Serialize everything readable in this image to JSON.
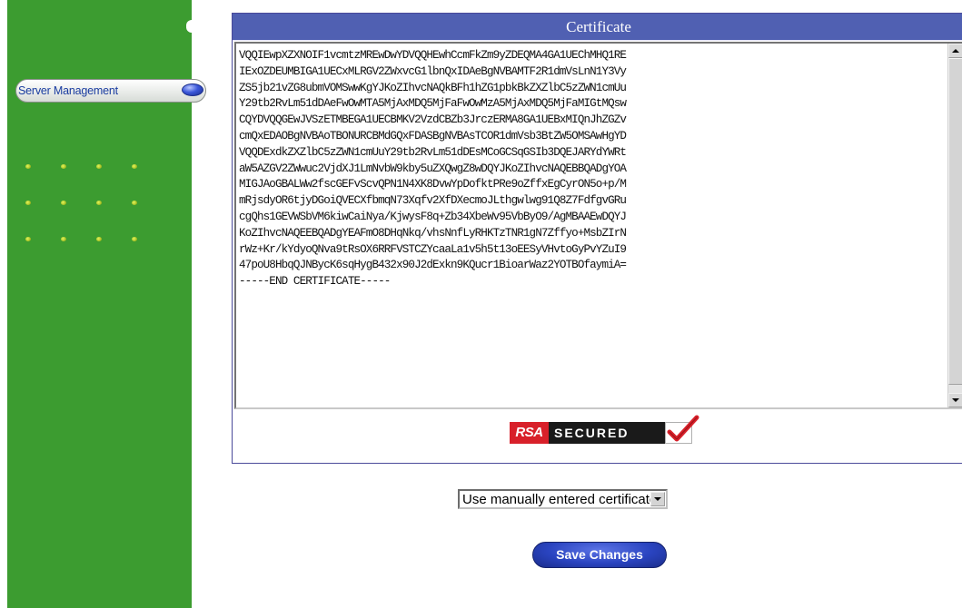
{
  "sidebar": {
    "nav_item_label": "Server Management",
    "dot_rows": 3,
    "dots_per_row": 4
  },
  "certificate": {
    "title": "Certificate",
    "lines": [
      "VQQIEwpXZXNOIF1vcmtzMREwDwYDVQQHEwhCcmFkZm9yZDEQMA4GA1UEChMHQ1RE",
      "IExOZDEUMBIGA1UECxMLRGV2ZWxvcG1lbnQxIDAeBgNVBAMTF2R1dmVsLnN1Y3Vy",
      "ZS5jb21vZG8ubmVOMSwwKgYJKoZIhvcNAQkBFh1hZG1pbkBkZXZlbC5zZWN1cmUu",
      "Y29tb2RvLm51dDAeFwOwMTA5MjAxMDQ5MjFaFwOwMzA5MjAxMDQ5MjFaMIGtMQsw",
      "CQYDVQQGEwJVSzETMBEGA1UECBMKV2VzdCBZb3JrczERMA8GA1UEBxMIQnJhZGZv",
      "cmQxEDAOBgNVBAoTBONURCBMdGQxFDASBgNVBAsTCOR1dmVsb3BtZW5OMSAwHgYD",
      "VQQDExdkZXZlbC5zZWN1cmUuY29tb2RvLm51dDEsMCoGCSqGSIb3DQEJARYdYWRt",
      "aW5AZGV2ZWwuc2VjdXJ1LmNvbW9kby5uZXQwgZ8wDQYJKoZIhvcNAQEBBQADgYOA",
      "MIGJAoGBALWw2fscGEFvScvQPN1N4XK8DvwYpDofktPRe9oZffxEgCyrON5o+p/M",
      "mRjsdyOR6tjyDGoiQVECXfbmqN73Xqfv2XfDXecmoJLthgwlwg91Q8Z7FdfgvGRu",
      "cgQhs1GEVWSbVM6kiwCaiNya/KjwysF8q+Zb34XbeWv95VbByO9/AgMBAAEwDQYJ",
      "KoZIhvcNAQEEBQADgYEAFmO8DHqNkq/vhsNnfLyRHKTzTNR1gN7Zffyo+MsbZIrN",
      "rWz+Kr/kYdyoQNva9tRsOX6RRFVSTCZYcaaLa1v5h5t13oEESyVHvtoGyPvYZuI9",
      "47poU8HbqQJNBycK6sqHygB432x90J2dExkn9KQucr1BioarWaz2YOTBOfaymiA=",
      "-----END CERTIFICATE-----"
    ],
    "badge_text_rsa": "RSA",
    "badge_text_secured": "SECURED"
  },
  "certificate_source": {
    "selected": "Use manually entered certificate"
  },
  "actions": {
    "save_label": "Save Changes"
  }
}
